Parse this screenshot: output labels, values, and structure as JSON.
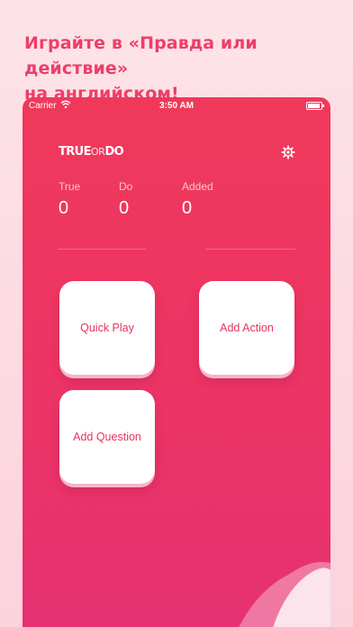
{
  "promo": {
    "line1": "Играйте в «Правда или действие»",
    "line2": "на английском!"
  },
  "status_bar": {
    "carrier": "Carrier",
    "time": "3:50 AM"
  },
  "app": {
    "logo": {
      "part1": "TRUE",
      "part2": "OR",
      "part3": "DO"
    },
    "stats": [
      {
        "label": "True",
        "value": "0"
      },
      {
        "label": "Do",
        "value": "0"
      },
      {
        "label": "Added",
        "value": "0"
      }
    ],
    "tiles": {
      "quick_play": "Quick Play",
      "add_action": "Add Action",
      "add_question": "Add Question"
    }
  },
  "colors": {
    "accent": "#ee3d6a",
    "background_gradient": [
      "#f0395a",
      "#e63173"
    ],
    "tile_text": "#e8325f"
  },
  "icons": [
    "wifi-icon",
    "battery-icon",
    "gear-icon"
  ]
}
